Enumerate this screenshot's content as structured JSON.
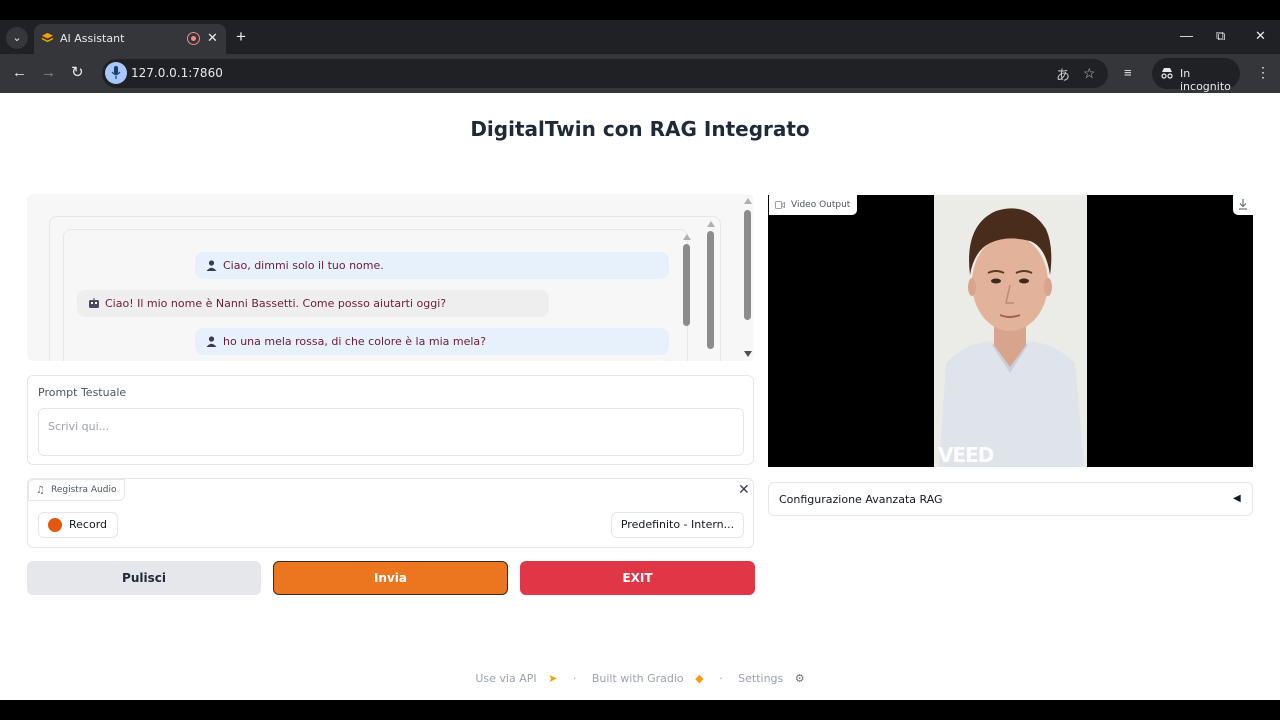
{
  "browser": {
    "tab_title": "AI Assistant",
    "url": "127.0.0.1:7860",
    "incognito_label": "In incognito"
  },
  "page": {
    "title": "DigitalTwin con RAG Integrato"
  },
  "chat": {
    "messages": [
      {
        "role": "user",
        "text": "Ciao, dimmi solo il tuo nome."
      },
      {
        "role": "bot",
        "text": "Ciao! Il mio nome è Nanni Bassetti. Come posso aiutarti oggi?"
      },
      {
        "role": "user",
        "text": "ho una mela rossa, di che colore è la mia mela?"
      }
    ]
  },
  "prompt": {
    "label": "Prompt Testuale",
    "placeholder": "Scrivi qui..."
  },
  "audio": {
    "label": "Registra Audio",
    "record_label": "Record",
    "device_label": "Predefinito - Intern..."
  },
  "buttons": {
    "clear": "Pulisci",
    "send": "Invia",
    "exit": "EXIT"
  },
  "video": {
    "label": "Video Output",
    "watermark": "VEED"
  },
  "rag": {
    "label": "Configurazione Avanzata RAG"
  },
  "footer": {
    "api": "Use via API",
    "built": "Built with Gradio",
    "settings": "Settings"
  },
  "colors": {
    "accent": "#ec7520",
    "exit": "#e03646",
    "message_text": "#6b1d36",
    "user_bubble": "#e6f1fb"
  }
}
